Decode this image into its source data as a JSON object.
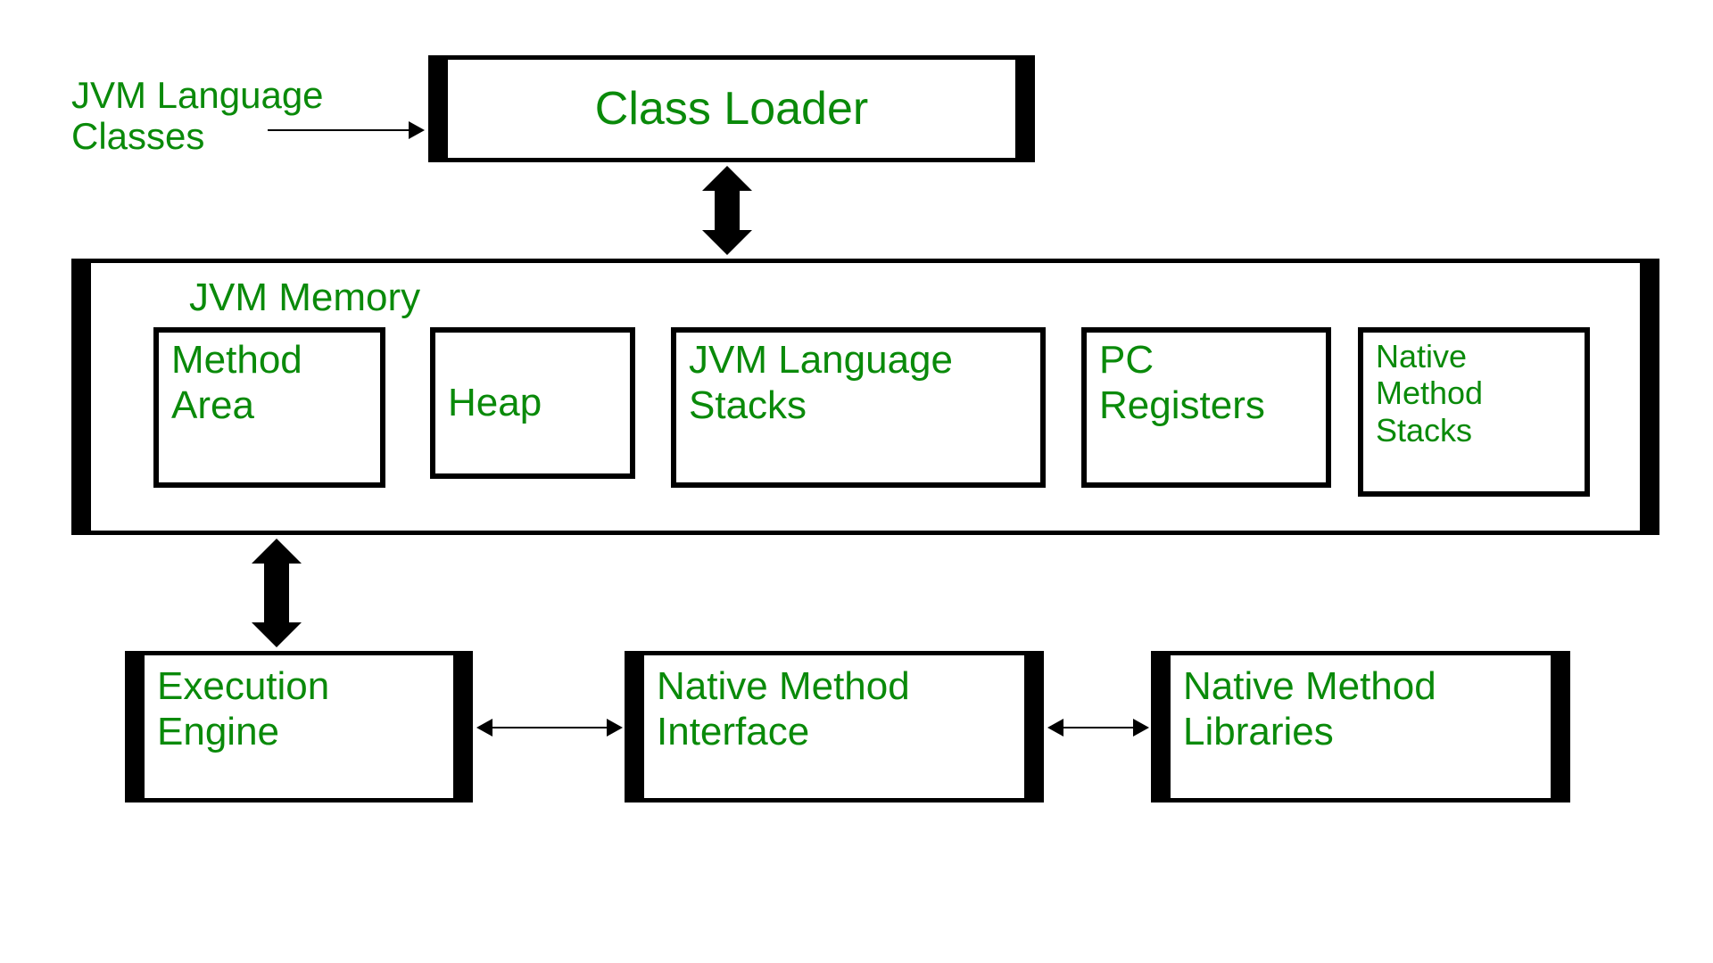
{
  "top": {
    "jvm_lang_classes_line1": "JVM Language",
    "jvm_lang_classes_line2": "Classes",
    "class_loader": "Class Loader"
  },
  "memory": {
    "title": "JVM Memory",
    "method_area_line1": "Method",
    "method_area_line2": "Area",
    "heap": "Heap",
    "stacks_line1": "JVM Language",
    "stacks_line2": "Stacks",
    "pc_line1": "PC",
    "pc_line2": "Registers",
    "native_line1": "Native",
    "native_line2": "Method",
    "native_line3": "Stacks"
  },
  "bottom": {
    "exec_line1": "Execution",
    "exec_line2": "Engine",
    "nmi_line1": "Native Method",
    "nmi_line2": "Interface",
    "nml_line1": "Native Method",
    "nml_line2": "Libraries"
  }
}
